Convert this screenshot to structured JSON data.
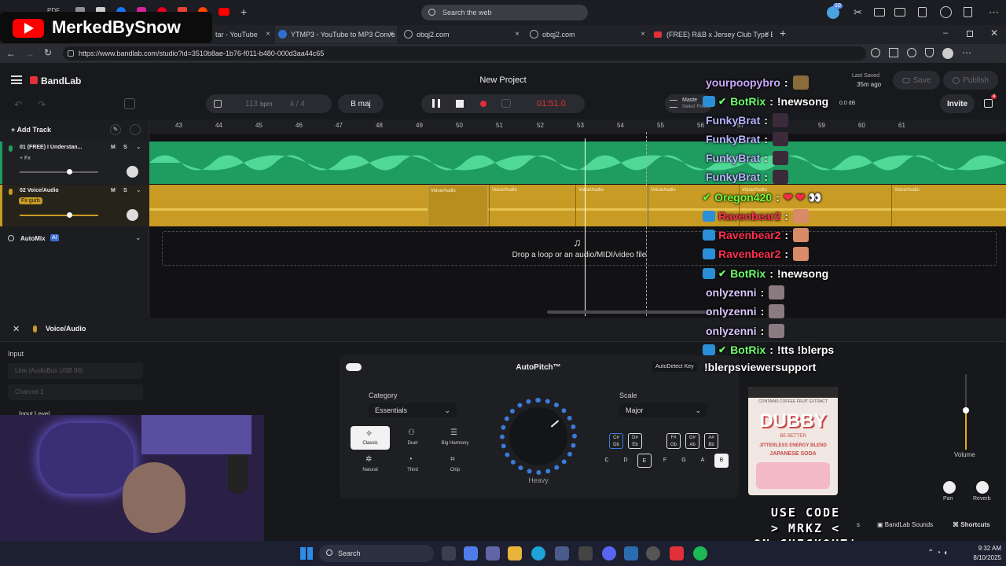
{
  "browser": {
    "search_placeholder": "Search the web",
    "url": "https://www.bandlab.com/studio?id=3510b8ae-1b76-f011-b480-000d3aa44c65",
    "tabs": [
      {
        "label": "tar - YouTube"
      },
      {
        "label": "YTMP3 - YouTube to MP3 Conve"
      },
      {
        "label": "obqj2.com"
      },
      {
        "label": "obqj2.com"
      },
      {
        "label": "(FREE) R&B x Jersey Club Type Be"
      }
    ],
    "pinned_label": "PDF",
    "notif_count": "10"
  },
  "stream_brand": "MerkedBySnow",
  "app": {
    "logo": "BandLab",
    "project_title": "New Project",
    "last_saved_label": "Last Saved",
    "last_saved_time": "35m ago",
    "save_label": "Save",
    "publish_label": "Publish",
    "invite_label": "Invite",
    "invite_badge": "4",
    "bpm_value": "113",
    "bpm_unit": "bpm",
    "time_sig": "4 / 4",
    "key": "B maj",
    "time": "01:51.0",
    "master_label": "Maste",
    "preset_label": "Select Preset",
    "db_value": "0.0 dB",
    "add_track_label": "Add Track",
    "drop_text": "Drop a loop or an audio/MIDI/video file",
    "automix_label": "AutoMix",
    "ai_label": "AI"
  },
  "ruler": [
    "43",
    "44",
    "45",
    "46",
    "47",
    "48",
    "49",
    "50",
    "51",
    "52",
    "53",
    "54",
    "55",
    "56",
    "57",
    "58",
    "59",
    "60",
    "61"
  ],
  "tracks": [
    {
      "name": "01  (FREE) I Understan...",
      "fx": "+ Fx",
      "m": "M",
      "s": "S"
    },
    {
      "name": "02  Voice/Audio",
      "fx": "Fx gurb",
      "m": "M",
      "s": "S"
    }
  ],
  "clips": [
    "Voice/Audio",
    "Voice/Audio",
    "Voice/Audio",
    "Voice/Audio",
    "Voice/Audio",
    "Voice/Audio"
  ],
  "panel": {
    "title": "Voice/Audio",
    "input_label": "Input",
    "input_device": "Line (AudioBox USB 96)",
    "channel": "Channel 1",
    "input_level": "Input Level",
    "autopitch_title": "AutoPitch™",
    "autodetect": "AutoDetect Key",
    "category_label": "Category",
    "category_value": "Essentials",
    "scale_label": "Scale",
    "scale_value": "Major",
    "knob_label": "Heavy",
    "effects": [
      "Classic",
      "Duet",
      "Big Harmony",
      "Natural",
      "Third",
      "Chip"
    ],
    "sharp_keys": [
      "C#\nDb",
      "D#\nEb",
      "F#\nGb",
      "G#\nAb",
      "A#\nBb"
    ],
    "keys": [
      "C",
      "D",
      "E",
      "F",
      "G",
      "A",
      "B"
    ],
    "volume_label": "Volume",
    "pan_label": "Pan",
    "reverb_label": "Reverb",
    "footer_sounds": "BandLab Sounds",
    "footer_shortcuts": "Shortcuts",
    "footer_partial": "s"
  },
  "chat": [
    {
      "user": "yourpoopybro",
      "msg": "",
      "color": "#c9a9ff"
    },
    {
      "user": "BotRix",
      "msg": "!newsong",
      "color": "#6dff6d"
    },
    {
      "user": "FunkyBrat",
      "msg": "",
      "color": "#b7b3ff"
    },
    {
      "user": "FunkyBrat",
      "msg": "",
      "color": "#b7b3ff"
    },
    {
      "user": "FunkyBrat",
      "msg": "",
      "color": "#b7b3ff"
    },
    {
      "user": "FunkyBrat",
      "msg": "",
      "color": "#b7b3ff"
    },
    {
      "user": "Oregon420",
      "msg": "",
      "color": "#6dff3a"
    },
    {
      "user": "Ravenbear2",
      "msg": "",
      "color": "#ff3050"
    },
    {
      "user": "Ravenbear2",
      "msg": "",
      "color": "#ff3050"
    },
    {
      "user": "Ravenbear2",
      "msg": "",
      "color": "#ff3050"
    },
    {
      "user": "BotRix",
      "msg": "!newsong",
      "color": "#6dff6d"
    },
    {
      "user": "onlyzenni",
      "msg": "",
      "color": "#d9c6ff"
    },
    {
      "user": "onlyzenni",
      "msg": "",
      "color": "#d9c6ff"
    },
    {
      "user": "onlyzenni",
      "msg": "",
      "color": "#d9c6ff"
    },
    {
      "user": "BotRix",
      "msg": "!tts !blerps",
      "color": "#6dff6d"
    },
    {
      "user": "",
      "msg": "!blerpsviewersupport",
      "color": "#ffffff"
    }
  ],
  "promo": [
    "USE CODE",
    "> MRKZ <",
    "ON CHECKOUT!"
  ],
  "can": {
    "brand": "DUBBY",
    "tagline": "BE BETTER",
    "line1": "JITTERLESS ENERGY BLEND",
    "line2": "JAPANESE SODA",
    "top": "CONTAINS COFFEE FRUIT EXTRACT"
  },
  "taskbar": {
    "search": "Search",
    "time": "9:32 AM",
    "date": "8/10/2025"
  },
  "colors": {
    "track_green": "#1f9d61",
    "track_gold": "#c79b24",
    "accent_red": "#e0313a"
  }
}
